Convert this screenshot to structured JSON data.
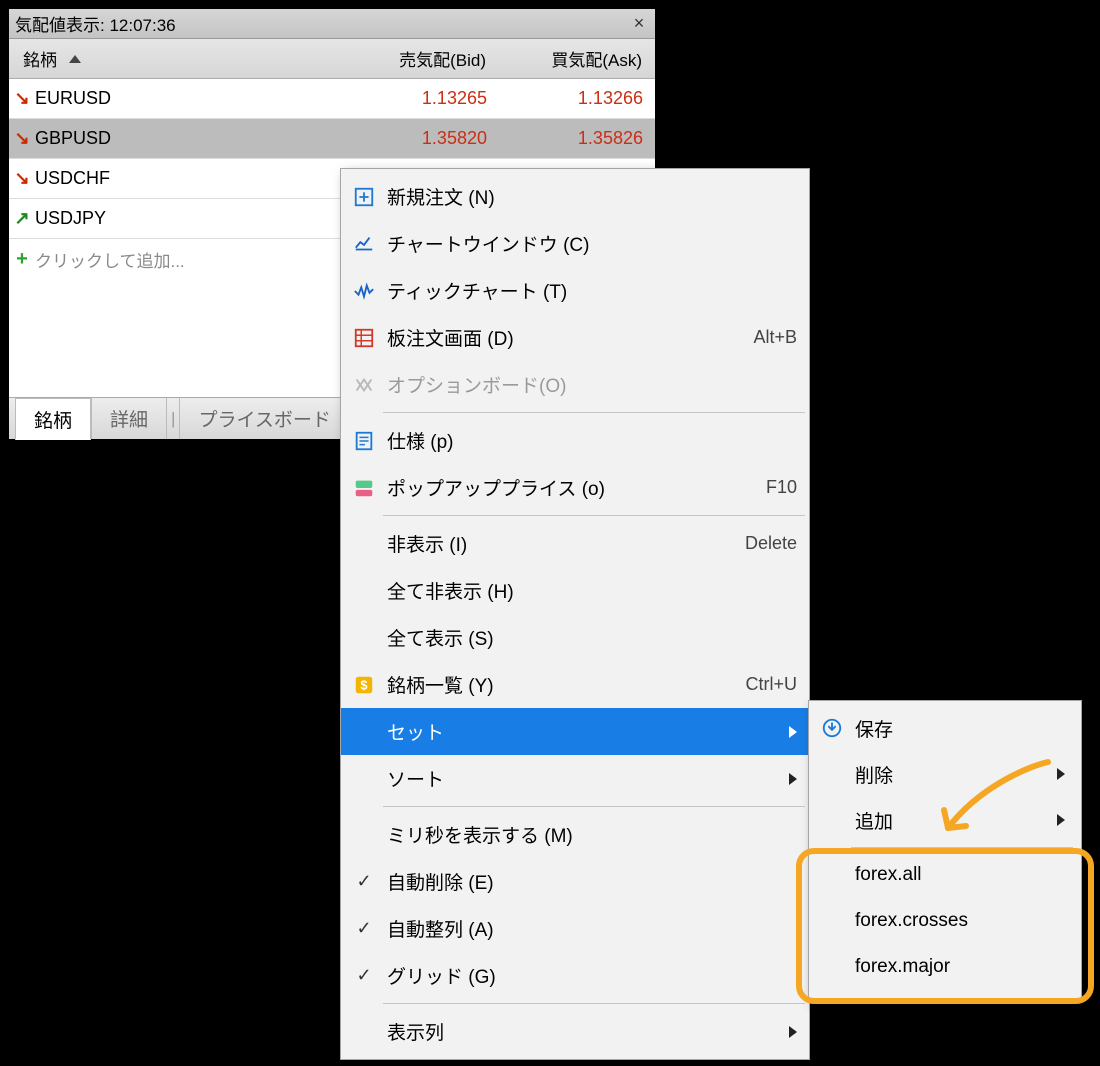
{
  "window": {
    "title": "気配値表示: 12:07:36",
    "close": "×"
  },
  "grid": {
    "headers": {
      "symbol": "銘柄",
      "bid": "売気配(Bid)",
      "ask": "買気配(Ask)"
    },
    "rows": [
      {
        "dir": "down",
        "symbol": "EURUSD",
        "bid": "1.13265",
        "ask": "1.13266",
        "color": "red"
      },
      {
        "dir": "down",
        "symbol": "GBPUSD",
        "bid": "1.35820",
        "ask": "1.35826",
        "color": "red",
        "selected": true
      },
      {
        "dir": "down",
        "symbol": "USDCHF",
        "bid": "",
        "ask": "",
        "color": ""
      },
      {
        "dir": "up",
        "symbol": "USDJPY",
        "bid": "",
        "ask": "",
        "color": ""
      }
    ],
    "add_row": "クリックして追加..."
  },
  "tabs": {
    "t0": "銘柄",
    "t1": "詳細",
    "t2": "プライスボード",
    "sep": "|"
  },
  "menu": {
    "new_order": {
      "label": "新規注文 (N)"
    },
    "chart_win": {
      "label": "チャートウインドウ (C)"
    },
    "tick_chart": {
      "label": "ティックチャート (T)"
    },
    "dom": {
      "label": "板注文画面 (D)",
      "accel": "Alt+B"
    },
    "options": {
      "label": "オプションボード(O)"
    },
    "spec": {
      "label": "仕様 (p)"
    },
    "popup": {
      "label": "ポップアッププライス (o)",
      "accel": "F10"
    },
    "hide": {
      "label": "非表示 (I)",
      "accel": "Delete"
    },
    "hide_all": {
      "label": "全て非表示 (H)"
    },
    "show_all": {
      "label": "全て表示 (S)"
    },
    "symbols": {
      "label": "銘柄一覧 (Y)",
      "accel": "Ctrl+U"
    },
    "sets": {
      "label": "セット"
    },
    "sort": {
      "label": "ソート"
    },
    "millis": {
      "label": "ミリ秒を表示する (M)"
    },
    "auto_del": {
      "label": "自動削除 (E)"
    },
    "auto_arr": {
      "label": "自動整列 (A)"
    },
    "grid": {
      "label": "グリッド (G)"
    },
    "columns": {
      "label": "表示列"
    }
  },
  "submenu": {
    "save": "保存",
    "delete": "削除",
    "add": "追加",
    "sets": {
      "s0": "forex.all",
      "s1": "forex.crosses",
      "s2": "forex.major"
    }
  }
}
